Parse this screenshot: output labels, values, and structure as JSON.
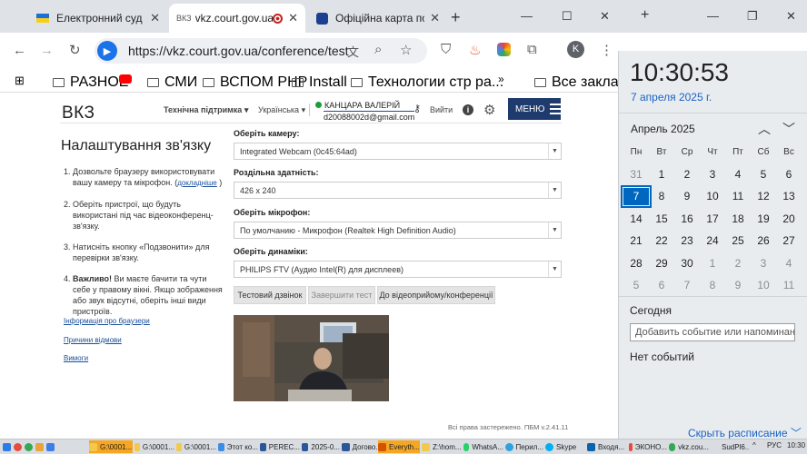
{
  "browser": {
    "tabs": [
      {
        "title": "Електронний суд",
        "active": false
      },
      {
        "title": "vkz.court.gov.ua",
        "active": true
      },
      {
        "title": "Офіційна карта по",
        "active": false
      }
    ],
    "url": "https://vkz.court.gov.ua/conference/test",
    "bookmarks": [
      "РАЗНОЕ",
      "СМИ",
      "ВСПОМ PHP",
      "Install",
      "Технологии стр ра...",
      "Все закладки"
    ],
    "avatar_letter": "K"
  },
  "page": {
    "logo": "ВКЗ",
    "nav": {
      "support": "Технічна підтримка",
      "lang": "Українська",
      "logout": "Вийти",
      "menu": "МЕНЮ"
    },
    "user": {
      "name": "КАНЦАРА ВАЛЕРІЙ",
      "email": "d20088002d@gmail.com"
    },
    "title": "Налаштування зв'язку",
    "steps": [
      {
        "pre": "Дозвольте браузеру використовувати вашу камеру та мікрофон. (",
        "link": "докладніше",
        "post": " )"
      },
      {
        "text": "Оберіть пристрої, що будуть використані під час відеоконференц-зв'язку."
      },
      {
        "text": "Натисніть кнопку «Подзвонити» для перевірки зв'язку."
      },
      {
        "bold": "Важливо!",
        "text": " Ви маєте бачити та чути себе у правому вікні. Якщо зображення або звук відсутні, оберіть інші види пристроїв."
      }
    ],
    "left_links": [
      "Інформація про браузери",
      "Причини відмови",
      "Вимоги"
    ],
    "fields": [
      {
        "label": "Оберіть камеру:",
        "value": "Integrated Webcam (0c45:64ad)"
      },
      {
        "label": "Роздільна здатність:",
        "value": "426 x 240"
      },
      {
        "label": "Оберіть мікрофон:",
        "value": "По умолчанию - Микрофон (Realtek High Definition Audio)"
      },
      {
        "label": "Оберіть динаміки:",
        "value": "PHILIPS FTV (Аудио Intel(R) для дисплеев)"
      }
    ],
    "buttons": {
      "test_call": "Тестовий дзвінок",
      "end_test": "Завершити тест",
      "to_conf": "До відеоприйому/конференції"
    },
    "footer": "Всі права застережено. ПБМ v.2.41.11"
  },
  "calendar": {
    "time": "10:30:53",
    "date": "7 апреля 2025 г.",
    "month": "Апрель 2025",
    "weekdays": [
      "Пн",
      "Вт",
      "Ср",
      "Чт",
      "Пт",
      "Сб",
      "Вс"
    ],
    "weeks": [
      [
        "31",
        "1",
        "2",
        "3",
        "4",
        "5",
        "6"
      ],
      [
        "7",
        "8",
        "9",
        "10",
        "11",
        "12",
        "13"
      ],
      [
        "14",
        "15",
        "16",
        "17",
        "18",
        "19",
        "20"
      ],
      [
        "21",
        "22",
        "23",
        "24",
        "25",
        "26",
        "27"
      ],
      [
        "28",
        "29",
        "30",
        "1",
        "2",
        "3",
        "4"
      ],
      [
        "5",
        "6",
        "7",
        "8",
        "9",
        "10",
        "11"
      ]
    ],
    "today_label": "Сегодня",
    "event_placeholder": "Добавить событие или напоминание",
    "no_events": "Нет событий",
    "hide_schedule": "Скрыть расписание"
  },
  "taskbar": {
    "items": [
      "G:\\0001...",
      "G:\\0001...",
      "G:\\0001...",
      "Этот ко...",
      "PEREC...",
      "2025-0...",
      "Догово...",
      "Everyth...",
      "Z:\\hom...",
      "WhatsA...",
      "Перил...",
      "Skype",
      "Входя...",
      "ЭКОНО...",
      "vkz.cou...",
      "SudPl6..."
    ],
    "lang": "РУС",
    "time": "10:30"
  }
}
